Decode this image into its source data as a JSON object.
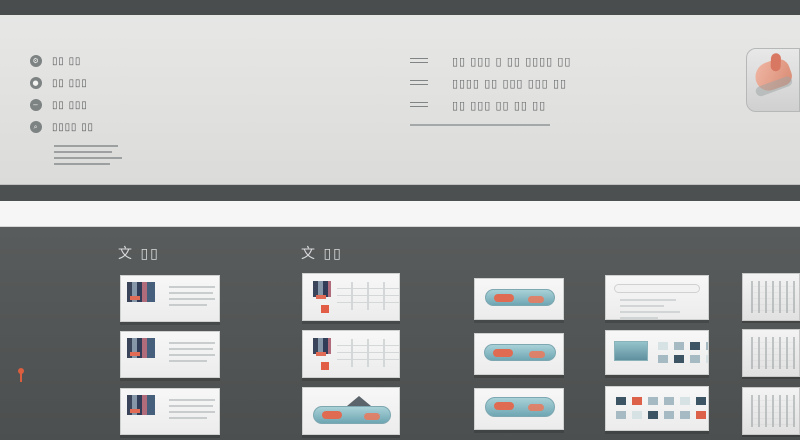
{
  "header": {
    "menu_items": [
      {
        "label": "▯▯ ▯▯",
        "icon": "settings-icon"
      },
      {
        "label": "▯▯ ▯▯▯",
        "icon": "circle-icon"
      },
      {
        "label": "▯▯ ▯▯▯",
        "icon": "minus-icon"
      },
      {
        "label": "▯▯▯▯ ▯▯",
        "icon": "search-icon"
      }
    ],
    "right_items": [
      {
        "label": "▯▯ ▯▯▯ ▯ ▯▯ ▯▯▯▯ ▯▯"
      },
      {
        "label": "▯▯▯▯ ▯▯ ▯▯▯ ▯▯▯ ▯▯"
      },
      {
        "label": "▯▯ ▯▯▯ ▯▯ ▯▯ ▯▯"
      }
    ]
  },
  "sections": [
    {
      "label": "文 ▯▯"
    },
    {
      "label": "文 ▯▯"
    }
  ],
  "colors": {
    "accent": "#e15d45",
    "teal": "#6ea6b3",
    "panel": "#f3f3f3",
    "dark": "#4c4f4f"
  }
}
